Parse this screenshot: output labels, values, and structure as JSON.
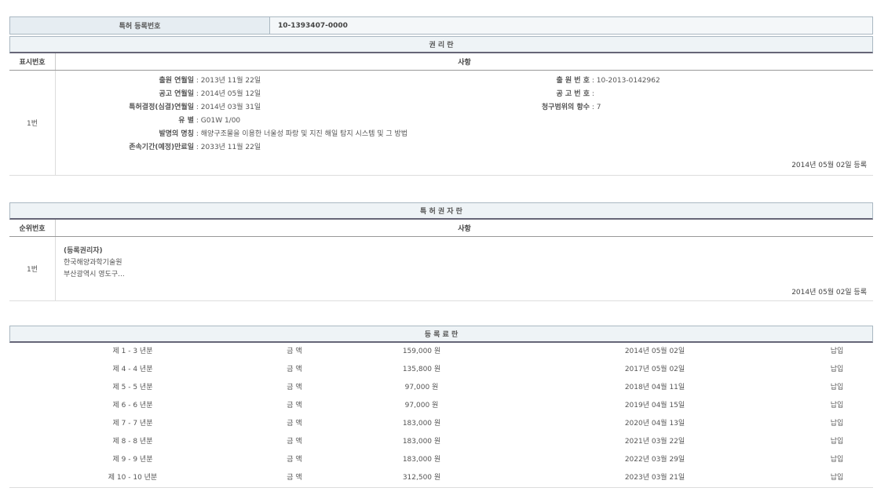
{
  "patent": {
    "label": "특허 등록번호",
    "number": "10-1393407-0000"
  },
  "rights": {
    "title": "권 리 란",
    "col_no": "표시번호",
    "col_matter": "사항",
    "row_no": "1번",
    "fields": {
      "app_date_label": "출원 연월일",
      "app_date": "2013년 11월 22일",
      "pub_date_label": "공고 연월일",
      "pub_date": "2014년 05월 12일",
      "decision_label": "특허결정(심결)연월일",
      "decision_date": "2014년 03월 31일",
      "class_label": "유 별",
      "class_value": "G01W 1/00",
      "title_label": "발명의 명칭",
      "title_value": "해양구조물을 이용한 너울성 파랑 및 지진 해일 탐지 시스템 및 그 방법",
      "expiry_label": "존속기간(예정)만료일",
      "expiry_date": "2033년 11월 22일",
      "app_no_label": "출 원 번 호",
      "app_no": "10-2013-0142962",
      "pub_no_label": "공 고 번 호",
      "pub_no": "",
      "claims_label": "청구범위의 항수",
      "claims": "7"
    },
    "reg_date": "2014년 05월 02일 등록"
  },
  "holders": {
    "title": "특 허 권 자 란",
    "col_no": "순위번호",
    "col_matter": "사항",
    "row_no": "1번",
    "role": "(등록권리자)",
    "name": "한국해양과학기술원",
    "address": "부산광역시 영도구...",
    "reg_date": "2014년 05월 02일 등록"
  },
  "fees": {
    "title": "등 록 료 란",
    "rows": [
      {
        "period": "제 1 - 3 년분",
        "label": "금 액",
        "amount": "159,000 원",
        "date": "2014년 05월 02일",
        "status": "납입"
      },
      {
        "period": "제 4 - 4 년분",
        "label": "금 액",
        "amount": "135,800 원",
        "date": "2017년 05월 02일",
        "status": "납입"
      },
      {
        "period": "제 5 - 5 년분",
        "label": "금 액",
        "amount": "97,000 원",
        "date": "2018년 04월 11일",
        "status": "납입"
      },
      {
        "period": "제 6 - 6 년분",
        "label": "금 액",
        "amount": "97,000 원",
        "date": "2019년 04월 15일",
        "status": "납입"
      },
      {
        "period": "제 7 - 7 년분",
        "label": "금 액",
        "amount": "183,000 원",
        "date": "2020년 04월 13일",
        "status": "납입"
      },
      {
        "period": "제 8 - 8 년분",
        "label": "금 액",
        "amount": "183,000 원",
        "date": "2021년 03월 22일",
        "status": "납입"
      },
      {
        "period": "제 9 - 9 년분",
        "label": "금 액",
        "amount": "183,000 원",
        "date": "2022년 03월 29일",
        "status": "납입"
      },
      {
        "period": "제 10 - 10 년분",
        "label": "금 액",
        "amount": "312,500 원",
        "date": "2023년 03월 21일",
        "status": "납입"
      }
    ]
  }
}
